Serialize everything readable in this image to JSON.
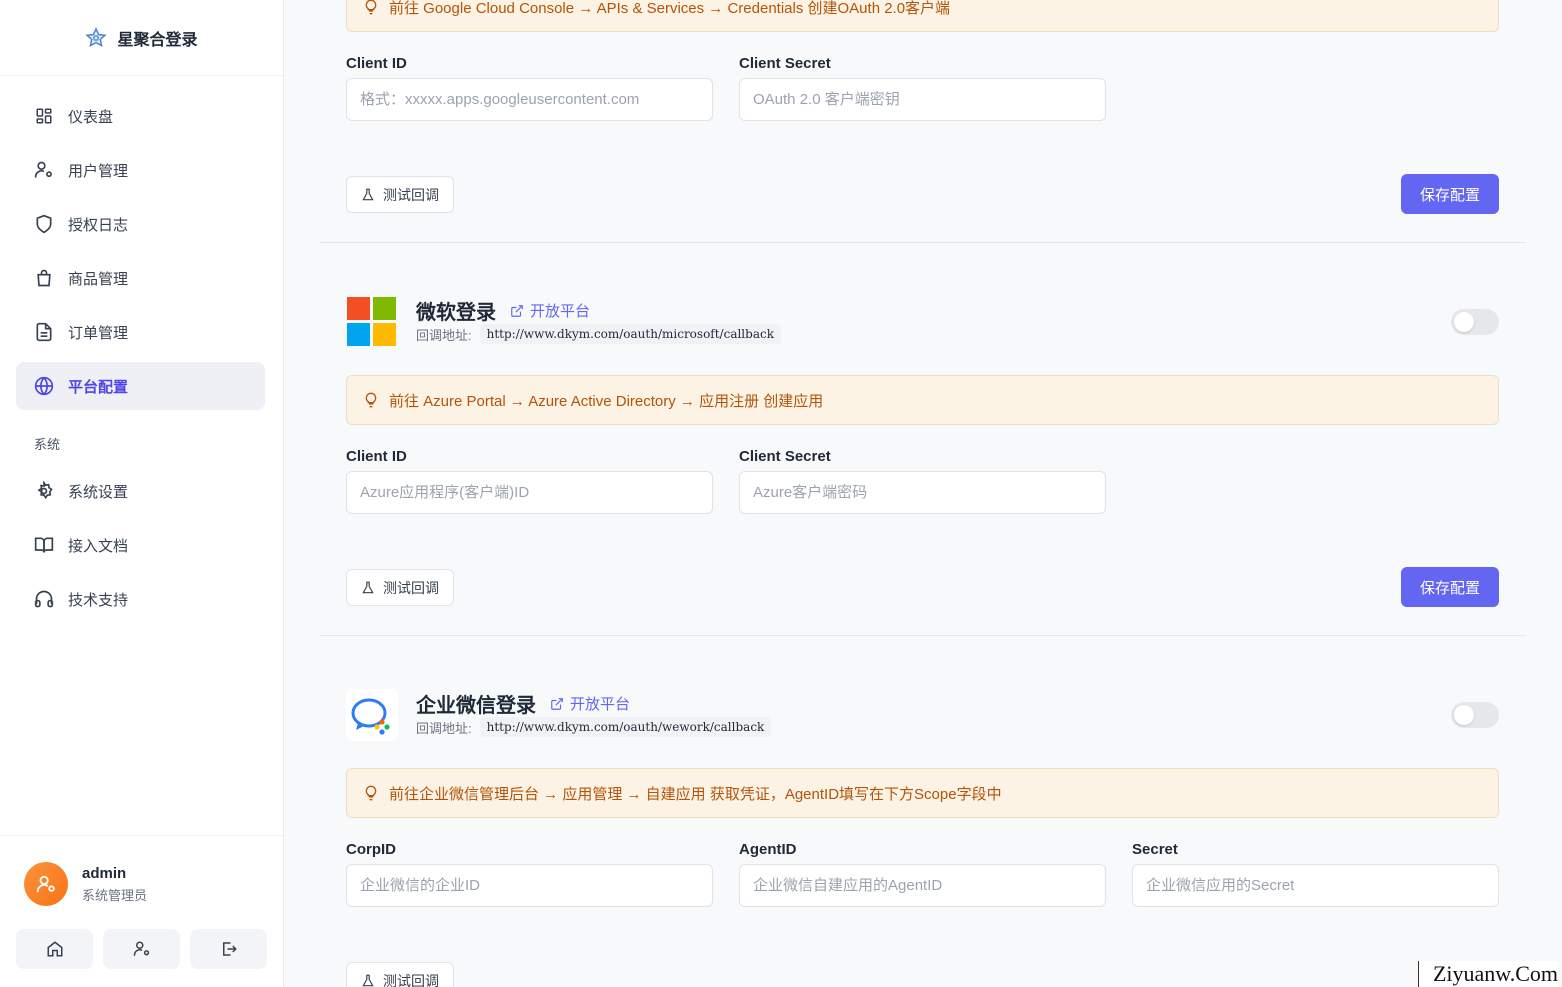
{
  "brand": {
    "name": "星聚合登录"
  },
  "sidebar": {
    "items": [
      {
        "label": "仪表盘",
        "icon": "dashboard-icon"
      },
      {
        "label": "用户管理",
        "icon": "user-cog-icon"
      },
      {
        "label": "授权日志",
        "icon": "shield-icon"
      },
      {
        "label": "商品管理",
        "icon": "shopping-bag-icon"
      },
      {
        "label": "订单管理",
        "icon": "file-text-icon"
      },
      {
        "label": "平台配置",
        "icon": "globe-icon",
        "active": true
      }
    ],
    "section": "系统",
    "system_items": [
      {
        "label": "系统设置",
        "icon": "gear-icon"
      },
      {
        "label": "接入文档",
        "icon": "book-icon"
      },
      {
        "label": "技术支持",
        "icon": "headset-icon"
      }
    ]
  },
  "user": {
    "name": "admin",
    "role": "系统管理员"
  },
  "google": {
    "hint": "前往 Google Cloud Console → APIs & Services → Credentials 创建OAuth 2.0客户端",
    "client_id_label": "Client ID",
    "client_id_placeholder": "格式：xxxxx.apps.googleusercontent.com",
    "client_secret_label": "Client Secret",
    "client_secret_placeholder": "OAuth 2.0 客户端密钥",
    "test_label": "测试回调",
    "save_label": "保存配置"
  },
  "microsoft": {
    "title": "微软登录",
    "open_label": "开放平台",
    "callback_label": "回调地址:",
    "callback_url": "http://www.dkym.com/oauth/microsoft/callback",
    "enabled": false,
    "hint": "前往 Azure Portal → Azure Active Directory → 应用注册 创建应用",
    "client_id_label": "Client ID",
    "client_id_placeholder": "Azure应用程序(客户端)ID",
    "client_secret_label": "Client Secret",
    "client_secret_placeholder": "Azure客户端密码",
    "test_label": "测试回调",
    "save_label": "保存配置"
  },
  "wework": {
    "title": "企业微信登录",
    "open_label": "开放平台",
    "callback_label": "回调地址:",
    "callback_url": "http://www.dkym.com/oauth/wework/callback",
    "enabled": false,
    "hint": "前往企业微信管理后台 → 应用管理 → 自建应用 获取凭证，AgentID填写在下方Scope字段中",
    "corpid_label": "CorpID",
    "corpid_placeholder": "企业微信的企业ID",
    "agentid_label": "AgentID",
    "agentid_placeholder": "企业微信自建应用的AgentID",
    "secret_label": "Secret",
    "secret_placeholder": "企业微信应用的Secret",
    "test_label": "测试回调"
  },
  "watermark": "Ziyuanw.Com",
  "colors": {
    "accent": "#6366f1",
    "hint_bg": "#fdf3e4",
    "hint_text": "#b45309"
  }
}
